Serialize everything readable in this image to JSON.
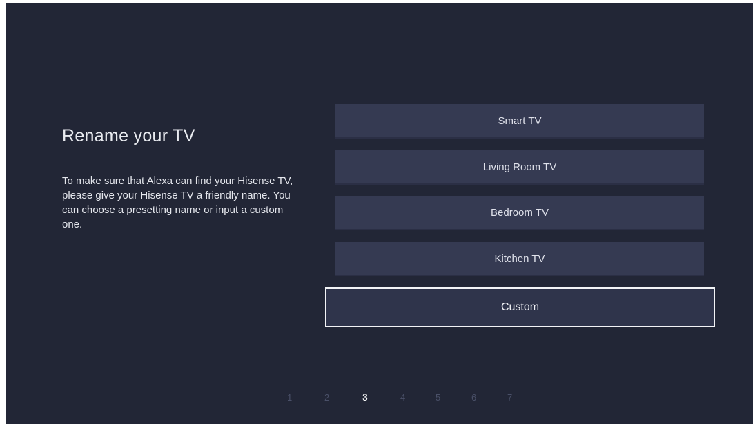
{
  "title": "Rename your TV",
  "description": "To make sure that Alexa can find your Hisense TV, please give your Hisense TV a friendly name. You can choose a presetting name or input a custom one.",
  "options": [
    {
      "label": "Smart TV"
    },
    {
      "label": "Living Room TV"
    },
    {
      "label": "Bedroom TV"
    },
    {
      "label": "Kitchen TV"
    },
    {
      "label": "Custom",
      "focused": true
    }
  ],
  "pager": {
    "pages": [
      "1",
      "2",
      "3",
      "4",
      "5",
      "6",
      "7"
    ],
    "current": "3"
  },
  "colors": {
    "background": "#222636",
    "option_background": "#353a52",
    "focus_border": "#f2f3f6",
    "inactive_page": "#4a5068",
    "active_page": "#ffffff"
  }
}
